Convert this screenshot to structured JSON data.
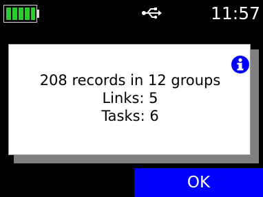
{
  "status_bar": {
    "battery_icon": "battery-full-icon",
    "battery_color": "#2ecc2e",
    "battery_level": 1.0,
    "usb_icon": "usb-icon",
    "time": "11:57"
  },
  "dialog": {
    "icon": "info-icon",
    "lines": [
      "208 records in 12 groups",
      "Links: 5",
      "Tasks: 6"
    ]
  },
  "ok_button": {
    "label": "OK",
    "color": "#0000ff"
  },
  "colors": {
    "background": "#000000",
    "dialog_background": "#ffffff",
    "dialog_shadow": "#808080",
    "info_icon": "#0000ff"
  }
}
